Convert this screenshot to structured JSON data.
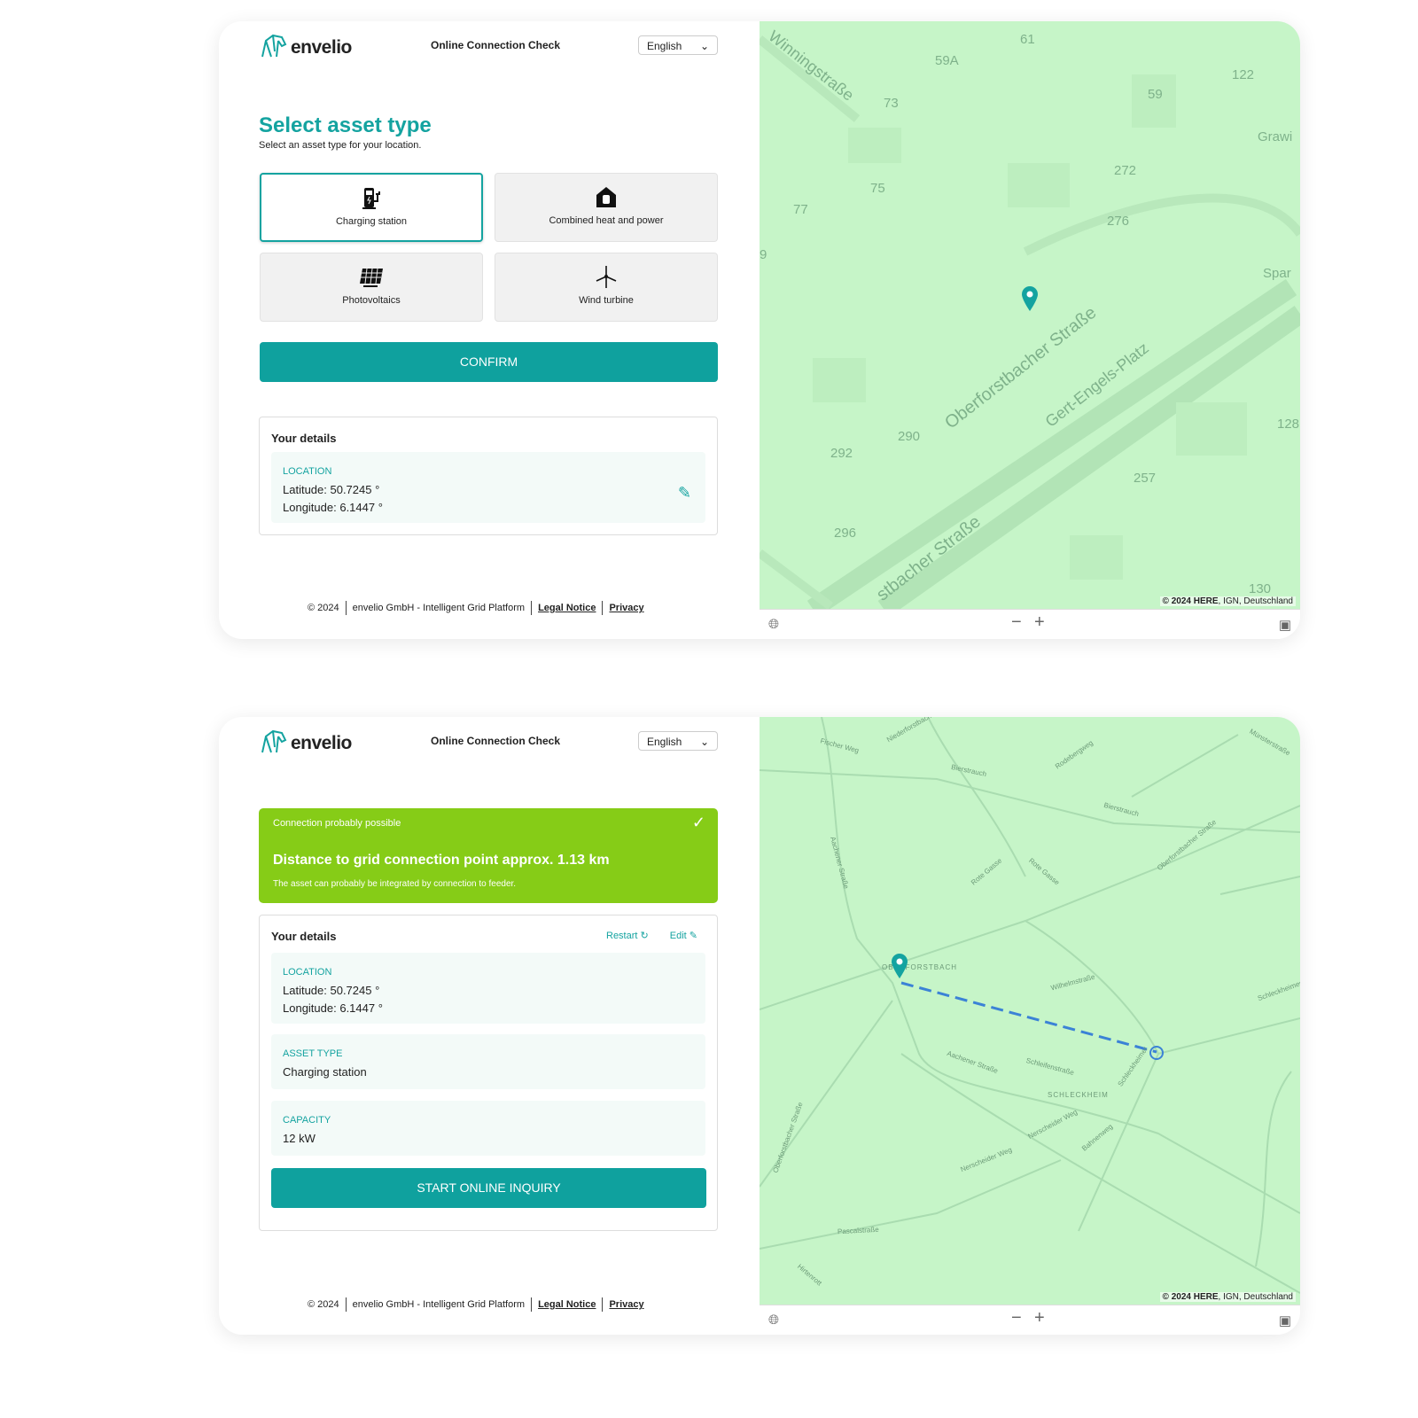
{
  "brand": {
    "name": "envelio",
    "accent": "#14a3a0",
    "success": "#86cc17"
  },
  "header": {
    "title": "Online Connection Check",
    "language": "English"
  },
  "screen1": {
    "title": "Select asset type",
    "subtitle": "Select an asset type for your location.",
    "asset_types": [
      {
        "label": "Charging station",
        "icon": "charging-station-icon",
        "selected": true
      },
      {
        "label": "Combined heat and power",
        "icon": "chp-house-icon",
        "selected": false
      },
      {
        "label": "Photovoltaics",
        "icon": "solar-panel-icon",
        "selected": false
      },
      {
        "label": "Wind turbine",
        "icon": "wind-turbine-icon",
        "selected": false
      }
    ],
    "confirm": "CONFIRM",
    "details": {
      "title": "Your details",
      "location_label": "LOCATION",
      "latitude": "Latitude: 50.7245 °",
      "longitude": "Longitude: 6.1447 °"
    },
    "map": {
      "streets": [
        "Winningstraße",
        "Oberforstbacher Straße",
        "Gert-Engels-Platz",
        "stbacher Straße",
        "Grawi",
        "Spar"
      ],
      "numbers": [
        "61",
        "59A",
        "73",
        "122",
        "59",
        "75",
        "272",
        "77",
        "276",
        "290",
        "292",
        "257",
        "296",
        "128",
        "130",
        "9"
      ]
    }
  },
  "screen2": {
    "banner": {
      "status": "Connection probably possible",
      "headline": "Distance to grid connection point approx. 1.13 km",
      "note": "The asset can probably be integrated by connection to feeder."
    },
    "details": {
      "title": "Your details",
      "restart": "Restart",
      "edit": "Edit",
      "location_label": "LOCATION",
      "latitude": "Latitude: 50.7245 °",
      "longitude": "Longitude: 6.1447 °",
      "asset_label": "ASSET TYPE",
      "asset_value": "Charging station",
      "capacity_label": "CAPACITY",
      "capacity_value": "12 kW"
    },
    "start": "START ONLINE INQUIRY",
    "map": {
      "labels": [
        "Fischer Weg",
        "Niederforstbacher",
        "Bierstrauch",
        "Rodebergweg",
        "Münsterstraße",
        "Bierstrauch",
        "Aachener Straße",
        "Rote Gasse",
        "Rote Gasse",
        "Oberforstbacher Straße",
        "OBERFORSTBACH",
        "Wilhelmstraße",
        "Aachener Straße",
        "Schleifenstraße",
        "SCHLECKHEIM",
        "Schleckheimer",
        "Nerscheider Weg",
        "Nerscheider Weg",
        "Pascalstraße",
        "Hirtenrott",
        "Oberforstbacher Straße",
        "Bahnenweg",
        "Schleckheimer Straße"
      ]
    }
  },
  "footer": {
    "copyright": "© 2024",
    "company": "envelio GmbH - Intelligent Grid Platform",
    "legal": "Legal Notice",
    "privacy": "Privacy"
  },
  "map_attribution": {
    "bold": "© 2024 HERE",
    "rest": ", IGN, Deutschland"
  }
}
